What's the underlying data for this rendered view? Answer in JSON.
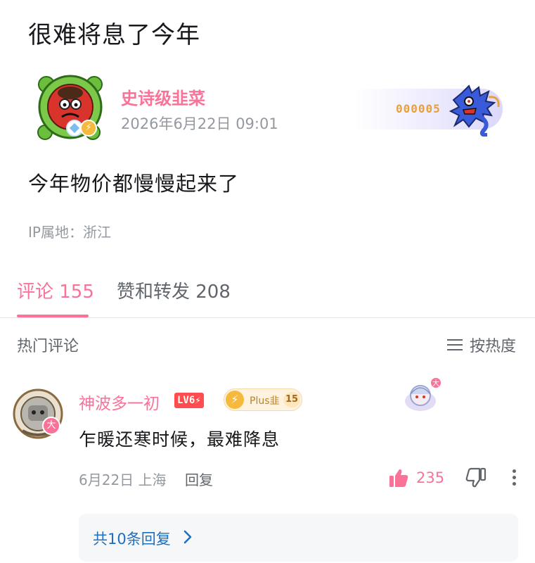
{
  "post": {
    "title": "很难将息了今年",
    "author": {
      "name": "史诗级韭菜",
      "time": "2026年6月22日 09:01"
    },
    "fan_badge_number": "000005",
    "content": "今年物价都慢慢起来了",
    "ip_location": "IP属地：浙江"
  },
  "tabs": {
    "comments": "评论 155",
    "likes_shares": "赞和转发 208"
  },
  "comments_section": {
    "hot_label": "热门评论",
    "sort_label": "按热度"
  },
  "comment": {
    "user_name": "神波多一初",
    "level_badge": "LV6⚡",
    "plus_label": "Plus韭",
    "plus_level": "15",
    "text": "乍暖还寒时候，最难降息",
    "date_location": "6月22日 上海",
    "reply_label": "回复",
    "like_count": "235",
    "replies_link": "共10条回复"
  },
  "colors": {
    "accent_pink": "#fb7299",
    "link_blue": "#1e6fbf",
    "secondary_text": "#9499a0",
    "primary_text": "#18191c"
  },
  "icons": {
    "sort": "menu-lines-icon",
    "like": "thumbs-up-icon",
    "dislike": "thumbs-down-icon",
    "more": "more-vertical-icon",
    "chevron": "chevron-right-icon"
  }
}
